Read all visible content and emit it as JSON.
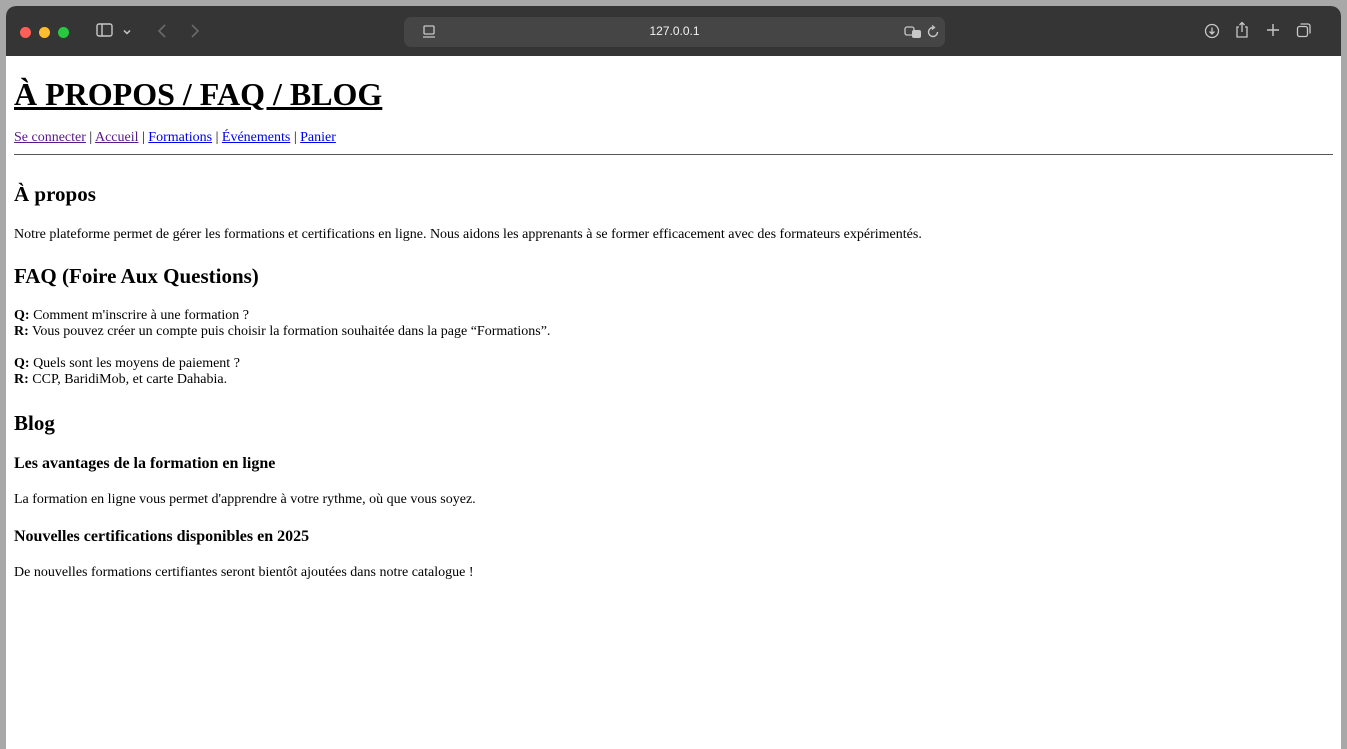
{
  "browser": {
    "url": "127.0.0.1",
    "icons": [
      "sidebar-icon",
      "chevron-down-icon",
      "back-icon",
      "forward-icon",
      "page-icon",
      "translate-icon",
      "reload-icon",
      "download-icon",
      "share-icon",
      "new-tab-icon",
      "tabs-overview-icon"
    ]
  },
  "page": {
    "title": "À PROPOS / FAQ / BLOG",
    "nav": {
      "login": "Se connecter",
      "home": "Accueil",
      "trainings": "Formations",
      "events": "Événements",
      "cart": "Panier",
      "separator": " | "
    },
    "about": {
      "heading": "À propos",
      "text": "Notre plateforme permet de gérer les formations et certifications en ligne. Nous aidons les apprenants à se former efficacement avec des formateurs expérimentés."
    },
    "faq": {
      "heading": "FAQ (Foire Aux Questions)",
      "q_label": "Q:",
      "r_label": "R:",
      "items": [
        {
          "q": "Comment m'inscrire à une formation ?",
          "r": "Vous pouvez créer un compte puis choisir la formation souhaitée dans la page “Formations”."
        },
        {
          "q": "Quels sont les moyens de paiement ?",
          "r": "CCP, BaridiMob, et carte Dahabia."
        }
      ]
    },
    "blog": {
      "heading": "Blog",
      "posts": [
        {
          "title": "Les avantages de la formation en ligne",
          "text": "La formation en ligne vous permet d'apprendre à votre rythme, où que vous soyez."
        },
        {
          "title": "Nouvelles certifications disponibles en 2025",
          "text": "De nouvelles formations certifiantes seront bientôt ajoutées dans notre catalogue !"
        }
      ]
    }
  }
}
